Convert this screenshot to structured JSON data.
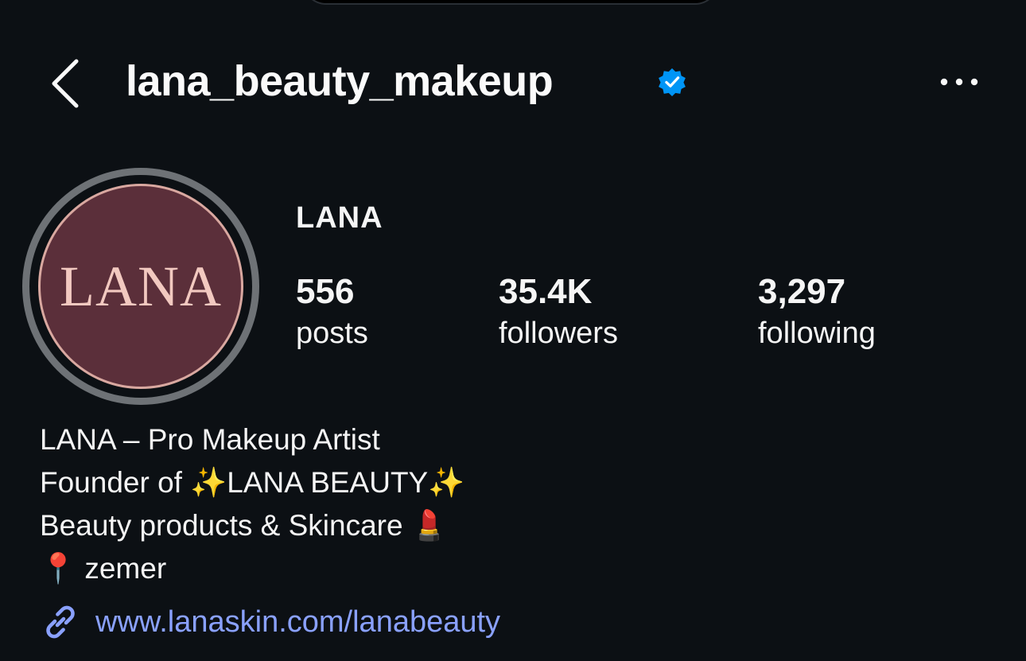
{
  "header": {
    "username": "lana_beauty_makeup"
  },
  "profile": {
    "avatar_text": "LANA",
    "display_name": "LANA",
    "stats": [
      {
        "value": "556",
        "label": "posts"
      },
      {
        "value": "35.4K",
        "label": "followers"
      },
      {
        "value": "3,297",
        "label": "following"
      }
    ],
    "bio": [
      "LANA – Pro Makeup Artist",
      "Founder of ✨LANA BEAUTY✨",
      "Beauty products & Skincare 💄",
      "📍 zemer"
    ],
    "link": "www.lanaskin.com/lanabeauty"
  },
  "icons": {
    "back": "chevron-left-icon",
    "verified": "verified-badge-icon",
    "more": "more-horizontal-icon",
    "link": "link-icon"
  },
  "colors": {
    "background": "#0c1014",
    "verified": "#0095f6",
    "link": "#8aa1ff",
    "avatar_bg": "#5b2f3a",
    "avatar_text": "#f2c9c0"
  }
}
